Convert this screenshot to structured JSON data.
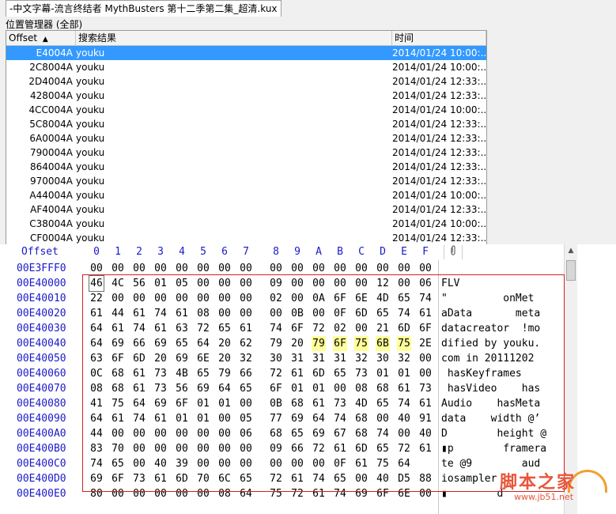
{
  "tab": {
    "title": "-中文字幕-流言终结者 MythBusters 第十二季第二集_超清.kux"
  },
  "panel": {
    "title": "位置管理器 (全部)"
  },
  "list": {
    "columns": {
      "offset": "Offset",
      "sort_indicator": "▲",
      "result": "搜索结果",
      "time": "时间"
    },
    "rows": [
      {
        "offset": "E4004A",
        "result": "youku",
        "time": "2014/01/24   10:00:...",
        "selected": true
      },
      {
        "offset": "2C8004A",
        "result": "youku",
        "time": "2014/01/24   10:00:..."
      },
      {
        "offset": "2D4004A",
        "result": "youku",
        "time": "2014/01/24   12:33:..."
      },
      {
        "offset": "428004A",
        "result": "youku",
        "time": "2014/01/24   12:33:..."
      },
      {
        "offset": "4CC004A",
        "result": "youku",
        "time": "2014/01/24   10:00:..."
      },
      {
        "offset": "5C8004A",
        "result": "youku",
        "time": "2014/01/24   12:33:..."
      },
      {
        "offset": "6A0004A",
        "result": "youku",
        "time": "2014/01/24   12:33:..."
      },
      {
        "offset": "790004A",
        "result": "youku",
        "time": "2014/01/24   12:33:..."
      },
      {
        "offset": "864004A",
        "result": "youku",
        "time": "2014/01/24   12:33:..."
      },
      {
        "offset": "970004A",
        "result": "youku",
        "time": "2014/01/24   12:33:..."
      },
      {
        "offset": "A44004A",
        "result": "youku",
        "time": "2014/01/24   10:00:..."
      },
      {
        "offset": "AF4004A",
        "result": "youku",
        "time": "2014/01/24   12:33:..."
      },
      {
        "offset": "C38004A",
        "result": "youku",
        "time": "2014/01/24   10:00:..."
      },
      {
        "offset": "CF0004A",
        "result": "youku",
        "time": "2014/01/24   12:33:..."
      }
    ]
  },
  "hex": {
    "header_offset": "Offset",
    "columns": [
      "0",
      "1",
      "2",
      "3",
      "4",
      "5",
      "6",
      "7",
      "8",
      "9",
      "A",
      "B",
      "C",
      "D",
      "E",
      "F"
    ],
    "rows": [
      {
        "offset": "00E3FFF0",
        "bytes": [
          "00",
          "00",
          "00",
          "00",
          "00",
          "00",
          "00",
          "00",
          "00",
          "00",
          "00",
          "00",
          "00",
          "00",
          "00",
          "00"
        ],
        "ascii": ""
      },
      {
        "offset": "00E40000",
        "bytes": [
          "46",
          "4C",
          "56",
          "01",
          "05",
          "00",
          "00",
          "00",
          "09",
          "00",
          "00",
          "00",
          "00",
          "12",
          "00",
          "06"
        ],
        "ascii": "FLV"
      },
      {
        "offset": "00E40010",
        "bytes": [
          "22",
          "00",
          "00",
          "00",
          "00",
          "00",
          "00",
          "00",
          "02",
          "00",
          "0A",
          "6F",
          "6E",
          "4D",
          "65",
          "74"
        ],
        "ascii": "\"         onMet"
      },
      {
        "offset": "00E40020",
        "bytes": [
          "61",
          "44",
          "61",
          "74",
          "61",
          "08",
          "00",
          "00",
          "00",
          "0B",
          "00",
          "0F",
          "6D",
          "65",
          "74",
          "61"
        ],
        "ascii": "aData       meta"
      },
      {
        "offset": "00E40030",
        "bytes": [
          "64",
          "61",
          "74",
          "61",
          "63",
          "72",
          "65",
          "61",
          "74",
          "6F",
          "72",
          "02",
          "00",
          "21",
          "6D",
          "6F"
        ],
        "ascii": "datacreator  !mo"
      },
      {
        "offset": "00E40040",
        "bytes": [
          "64",
          "69",
          "66",
          "69",
          "65",
          "64",
          "20",
          "62",
          "79",
          "20",
          "79",
          "6F",
          "75",
          "6B",
          "75",
          "2E"
        ],
        "ascii": "dified by youku."
      },
      {
        "offset": "00E40050",
        "bytes": [
          "63",
          "6F",
          "6D",
          "20",
          "69",
          "6E",
          "20",
          "32",
          "30",
          "31",
          "31",
          "31",
          "32",
          "30",
          "32",
          "00"
        ],
        "ascii": "com in 20111202"
      },
      {
        "offset": "00E40060",
        "bytes": [
          "0C",
          "68",
          "61",
          "73",
          "4B",
          "65",
          "79",
          "66",
          "72",
          "61",
          "6D",
          "65",
          "73",
          "01",
          "01",
          "00"
        ],
        "ascii": " hasKeyframes"
      },
      {
        "offset": "00E40070",
        "bytes": [
          "08",
          "68",
          "61",
          "73",
          "56",
          "69",
          "64",
          "65",
          "6F",
          "01",
          "01",
          "00",
          "08",
          "68",
          "61",
          "73"
        ],
        "ascii": " hasVideo    has"
      },
      {
        "offset": "00E40080",
        "bytes": [
          "41",
          "75",
          "64",
          "69",
          "6F",
          "01",
          "01",
          "00",
          "0B",
          "68",
          "61",
          "73",
          "4D",
          "65",
          "74",
          "61"
        ],
        "ascii": "Audio    hasMeta"
      },
      {
        "offset": "00E40090",
        "bytes": [
          "64",
          "61",
          "74",
          "61",
          "01",
          "01",
          "00",
          "05",
          "77",
          "69",
          "64",
          "74",
          "68",
          "00",
          "40",
          "91"
        ],
        "ascii": "data    width @’"
      },
      {
        "offset": "00E400A0",
        "bytes": [
          "44",
          "00",
          "00",
          "00",
          "00",
          "00",
          "00",
          "06",
          "68",
          "65",
          "69",
          "67",
          "68",
          "74",
          "00",
          "40"
        ],
        "ascii": "D        height @"
      },
      {
        "offset": "00E400B0",
        "bytes": [
          "83",
          "70",
          "00",
          "00",
          "00",
          "00",
          "00",
          "00",
          "09",
          "66",
          "72",
          "61",
          "6D",
          "65",
          "72",
          "61"
        ],
        "ascii": "▮p        framera"
      },
      {
        "offset": "00E400C0",
        "bytes": [
          "74",
          "65",
          "00",
          "40",
          "39",
          "00",
          "00",
          "00",
          "00",
          "00",
          "00",
          "0F",
          "61",
          "75",
          "64"
        ],
        "ascii": "te @9        aud"
      },
      {
        "offset": "00E400D0",
        "bytes": [
          "69",
          "6F",
          "73",
          "61",
          "6D",
          "70",
          "6C",
          "65",
          "72",
          "61",
          "74",
          "65",
          "00",
          "40",
          "D5",
          "88"
        ],
        "ascii": "iosampler"
      },
      {
        "offset": "00E400E0",
        "bytes": [
          "80",
          "00",
          "00",
          "00",
          "00",
          "00",
          "08",
          "64",
          "75",
          "72",
          "61",
          "74",
          "69",
          "6F",
          "6E",
          "00"
        ],
        "ascii": "▮        d"
      }
    ],
    "highlight": {
      "row": 5,
      "from": 10,
      "to": 14
    }
  },
  "icons": {
    "attach": "paperclip-icon",
    "scroll_up": "scroll-up-arrow-icon"
  },
  "watermark": {
    "text": "脚本之家",
    "url": "www.jb51.net"
  },
  "colors": {
    "selection": "#3399ff",
    "offset_blue": "#1a1ac8",
    "highlight": "#ffff99",
    "red_box": "#d32020"
  }
}
